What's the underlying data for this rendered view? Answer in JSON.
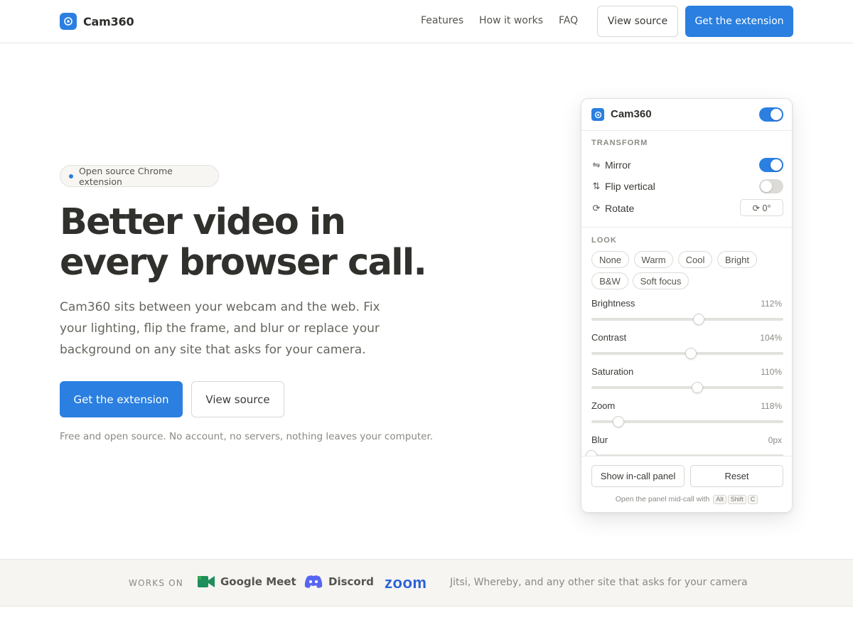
{
  "nav": {
    "brand": "Cam360",
    "links": [
      "Features",
      "How it works",
      "FAQ"
    ],
    "view_source": "View source",
    "get_extension": "Get the extension"
  },
  "hero": {
    "pill": "Open source Chrome extension",
    "headline_lines": [
      "Better video in",
      "every browser call."
    ],
    "subtext_lines": [
      "Cam360 sits between your webcam and the web. Fix",
      "your lighting, flip the frame, and blur or replace your",
      "background on any site that asks for your camera."
    ],
    "cta_primary": "Get the extension",
    "cta_secondary": "View source",
    "footnote": "Free and open source. No account, no servers, nothing leaves your computer."
  },
  "panel": {
    "title": "Cam360",
    "enabled": true,
    "transform": {
      "label": "TRANSFORM",
      "mirror": {
        "label": "Mirror",
        "on": true
      },
      "flip": {
        "label": "Flip vertical",
        "on": false
      },
      "rotate": {
        "label": "Rotate",
        "value": "⟳ 0°"
      }
    },
    "look": {
      "label": "LOOK",
      "presets": [
        "None",
        "Warm",
        "Cool",
        "Bright",
        "B&W",
        "Soft focus"
      ]
    },
    "sliders": [
      {
        "label": "Brightness",
        "value": "112%",
        "fraction": 0.56
      },
      {
        "label": "Contrast",
        "value": "104%",
        "fraction": 0.52
      },
      {
        "label": "Saturation",
        "value": "110%",
        "fraction": 0.55
      },
      {
        "label": "Zoom",
        "value": "118%",
        "fraction": 0.14
      },
      {
        "label": "Blur",
        "value": "0px",
        "fraction": 0.0
      }
    ],
    "show_panel": "Show in-call panel",
    "reset": "Reset",
    "hint": "Open the panel mid-call with",
    "keys": [
      "Alt",
      "Shift",
      "C"
    ]
  },
  "works_on": {
    "label": "WORKS ON",
    "google_meet": "Google Meet",
    "discord": "Discord",
    "zoom": "zoom",
    "more": "Jitsi, Whereby, and any other site that asks for your camera"
  },
  "colors": {
    "accent": "#2a7fe0",
    "meet_green": "#1e8e5a",
    "discord": "#5865f2",
    "zoom": "#2a60d8"
  }
}
